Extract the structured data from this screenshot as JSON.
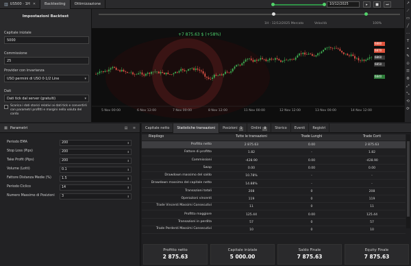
{
  "topbar": {
    "tabs": [
      {
        "label": "US500 · 1H",
        "icon": "chart-icon"
      },
      {
        "label": "Backtesting",
        "icon": ""
      },
      {
        "label": "Ottimizzazione",
        "icon": ""
      }
    ],
    "date": "10/12/2025",
    "buttons": [
      "▸",
      "■",
      "⏭"
    ]
  },
  "chart": {
    "header_left": "1H · 12/12/2025 Mercato",
    "header_volume": "Velocità",
    "header_speed": "100%",
    "price_badge": "+7 875.63 $ (+58%)",
    "side_prices": [
      {
        "label": "6880",
        "color": "#e0533d"
      },
      {
        "label": "6870",
        "color": "#e0533d"
      },
      {
        "label": "6860",
        "color": "#3a3a3a"
      },
      {
        "label": "6850",
        "color": "#3a3a3a"
      },
      {
        "label": "6840",
        "color": "#2e7d3a"
      }
    ],
    "x_labels": [
      "5 Nov 00:00",
      "6 Nov 12:00",
      "7 Nov 00:00",
      "8 Nov 12:00",
      "11 Nov 00:00",
      "12 Nov 12:00",
      "13 Nov 00:00",
      "14 Nov 12:00"
    ]
  },
  "backtest": {
    "title": "Impostazioni Backtest",
    "capital_label": "Capitale iniziale",
    "capital_value": "5000",
    "commission_label": "Commissione",
    "commission_value": "25",
    "provider_label": "Provider con invarianza",
    "provider_value": "USO permini di USO 0·1/2 Line",
    "data_label": "Dati",
    "data_value": "Dati tick dal server (gratuiti)",
    "checkbox_text": "Scarica i dati storici relativi ai dati tick e convertirli con parametri profitti e margini nella valuta del conto"
  },
  "params": {
    "title": "Parametri",
    "rows": [
      {
        "label": "Periodo EMA",
        "value": "200"
      },
      {
        "label": "Stop Loss (Pips)",
        "value": "200"
      },
      {
        "label": "Take Profit (Pips)",
        "value": "200"
      },
      {
        "label": "Volume (Lotti)",
        "value": "0.1"
      },
      {
        "label": "Fattore Distanza Medie (%)",
        "value": "1.5"
      },
      {
        "label": "Periodo Ciclico",
        "value": "14"
      },
      {
        "label": "Numero Massimo di Posizioni",
        "value": "3"
      }
    ]
  },
  "results": {
    "tabs": [
      {
        "label": "Capitale netto",
        "badge": ""
      },
      {
        "label": "Statistiche transazioni",
        "badge": ""
      },
      {
        "label": "Posizioni",
        "badge": "1"
      },
      {
        "label": "Ordini",
        "badge": "8"
      },
      {
        "label": "Storico",
        "badge": ""
      },
      {
        "label": "Eventi",
        "badge": ""
      },
      {
        "label": "Registri",
        "badge": ""
      }
    ],
    "columns": [
      "Riepilogo",
      "Tutte le transazioni",
      "Trade Lunghi",
      "Trade Corti"
    ],
    "rows": [
      {
        "label": "Profitto netto",
        "all": "2 875.63",
        "long": "0.00",
        "short": "2 875.63",
        "sel": true
      },
      {
        "label": "Fattore di profitto",
        "all": "1.82",
        "long": "-",
        "short": "1.82"
      },
      {
        "label": "Commissioni",
        "all": "-428.90",
        "long": "0.00",
        "short": "-428.90"
      },
      {
        "label": "Swap",
        "all": "0.00",
        "long": "0.00",
        "short": "0.00"
      },
      {
        "label": "Drawdown massimo del saldo",
        "all": "10.78%",
        "long": "-",
        "short": "-"
      },
      {
        "label": "Drawdown massimo del capitale netto",
        "all": "14.88%",
        "long": "-",
        "short": "-"
      },
      {
        "label": "Transazioni totali",
        "all": "208",
        "long": "0",
        "short": "208"
      },
      {
        "label": "Operazioni vincenti",
        "all": "119",
        "long": "0",
        "short": "119"
      },
      {
        "label": "Trade Vincenti Massimi Consecutivi",
        "all": "11",
        "long": "0",
        "short": "11"
      },
      {
        "label": "Profitto maggiore",
        "all": "125.44",
        "long": "0.00",
        "short": "125.44"
      },
      {
        "label": "Transazioni in perdita",
        "all": "57",
        "long": "0",
        "short": "57"
      },
      {
        "label": "Trade Perdenti Massimi Consecutivi",
        "all": "10",
        "long": "0",
        "short": "10"
      }
    ],
    "summary": [
      {
        "title": "Profitto netto",
        "value": "2 875.63"
      },
      {
        "title": "Capitale iniziale",
        "value": "5 000.00"
      },
      {
        "title": "Saldo Finale",
        "value": "7 875.63"
      },
      {
        "title": "Equity Finale",
        "value": "7 875.63"
      }
    ]
  },
  "toolbar_right": [
    "↗",
    "⟋",
    "▭",
    "╱",
    "⋯",
    "T",
    "⌖",
    "✎",
    "⊙",
    "☰",
    "⚙",
    "⤢",
    "⤡",
    "⟲",
    "⟳"
  ]
}
